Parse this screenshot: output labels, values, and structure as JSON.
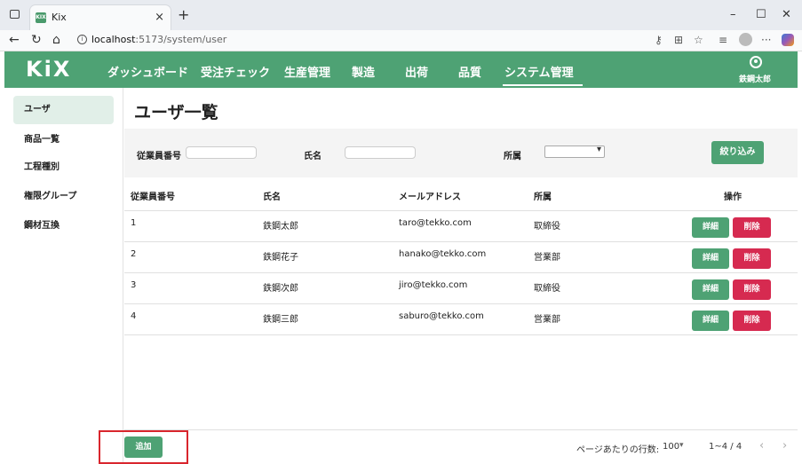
{
  "browser": {
    "tab_title": "Kix",
    "favicon_text": "KIX",
    "new_tab": "+",
    "close_tab": "×",
    "url_host": "localhost",
    "url_path": ":5173/system/user",
    "window_controls": [
      "–",
      "☐",
      "✕"
    ]
  },
  "app": {
    "logo": "KiX",
    "nav": [
      {
        "label": "ダッシュボード"
      },
      {
        "label": "受注チェック"
      },
      {
        "label": "生産管理"
      },
      {
        "label": "製造"
      },
      {
        "label": "出荷"
      },
      {
        "label": "品質"
      },
      {
        "label": "システム管理"
      }
    ],
    "active_nav": "システム管理",
    "user_name": "鉄鋼太郎"
  },
  "sidebar": {
    "items": [
      {
        "label": "ユーザ"
      },
      {
        "label": "商品一覧"
      },
      {
        "label": "工程種別"
      },
      {
        "label": "権限グループ"
      },
      {
        "label": "鋼材互換"
      }
    ]
  },
  "page": {
    "title": "ユーザ一覧"
  },
  "filter": {
    "employee_no_label": "従業員番号",
    "employee_no_value": "",
    "name_label": "氏名",
    "name_value": "",
    "dept_label": "所属",
    "dept_value": "",
    "submit_label": "絞り込み"
  },
  "table": {
    "headers": [
      "従業員番号",
      "氏名",
      "メールアドレス",
      "所属",
      "操作"
    ],
    "rows": [
      {
        "id": "1",
        "name": "鉄鋼太郎",
        "email": "taro@tekko.com",
        "dept": "取締役"
      },
      {
        "id": "2",
        "name": "鉄鋼花子",
        "email": "hanako@tekko.com",
        "dept": "営業部"
      },
      {
        "id": "3",
        "name": "鉄鋼次郎",
        "email": "jiro@tekko.com",
        "dept": "取締役"
      },
      {
        "id": "4",
        "name": "鉄鋼三郎",
        "email": "saburo@tekko.com",
        "dept": "営業部"
      }
    ],
    "detail_label": "詳細",
    "delete_label": "削除"
  },
  "footer": {
    "add_label": "追加",
    "rows_per_page_label": "ページあたりの行数:",
    "rows_per_page_value": "100",
    "range": "1~4 / 4",
    "prev": "‹",
    "next": "›"
  },
  "colors": {
    "brand": "#4ea274",
    "danger": "#d62a50",
    "highlight": "#d9262d"
  }
}
